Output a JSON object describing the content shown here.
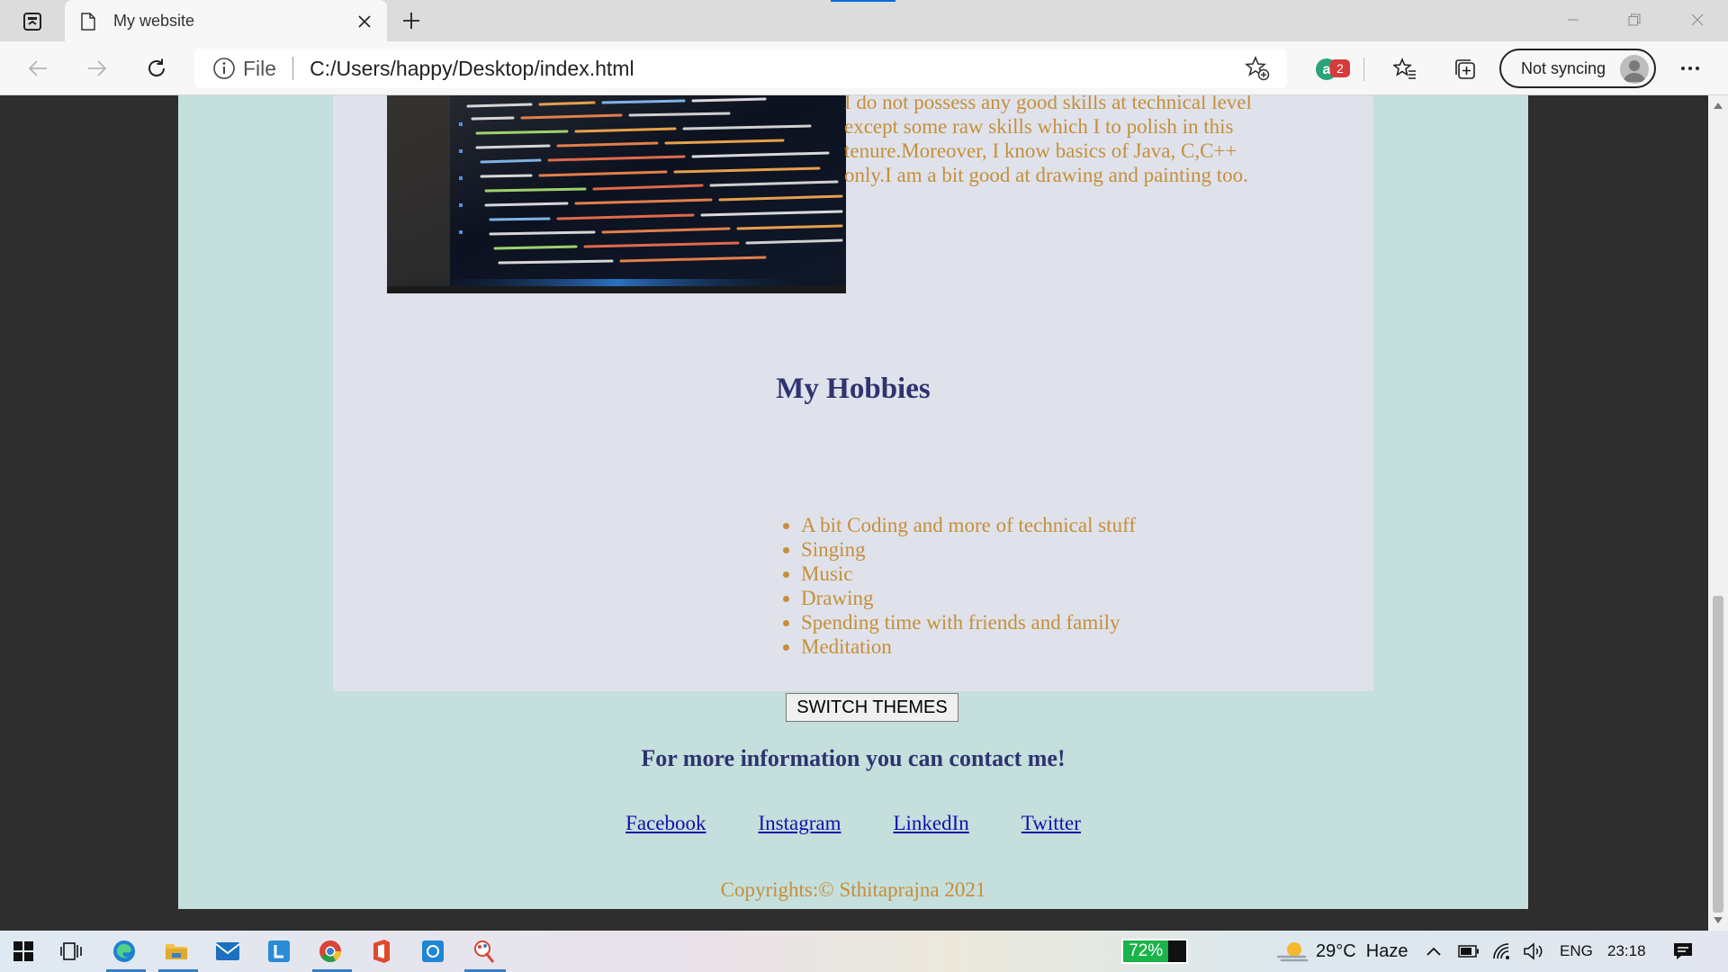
{
  "browser": {
    "tab_title": "My website",
    "address_scheme": "File",
    "address_url": "C:/Users/happy/Desktop/index.html",
    "extension_badge": "2",
    "sync_label": "Not syncing"
  },
  "page": {
    "about_text": "I do not possess any good skills at technical level except some raw skills which I to polish in this tenure.Moreover, I know basics of Java, C,C++ only.I am a bit good at drawing and painting too.",
    "hobbies_heading": "My Hobbies",
    "hobbies": [
      "A bit Coding and more of technical stuff",
      "Singing",
      "Music",
      "Drawing",
      "Spending time with friends and family",
      "Meditation"
    ],
    "switch_button": "SWITCH THEMES",
    "contact_heading": "For more information you can contact me!",
    "links": [
      "Facebook",
      "Instagram",
      "LinkedIn",
      "Twitter"
    ],
    "copyright": "Copyrights:© Sthitaprajna 2021"
  },
  "taskbar": {
    "battery_percent": "72%",
    "battery_level": 0.72,
    "weather": "29°C  Haze",
    "language": "ENG",
    "time": "23:18"
  },
  "colors": {
    "page_bg": "#c4dfdc",
    "card_bg": "#dfe2ea",
    "heading": "#2f3370",
    "body_text": "#c58f3b",
    "link": "#1a0dab"
  }
}
